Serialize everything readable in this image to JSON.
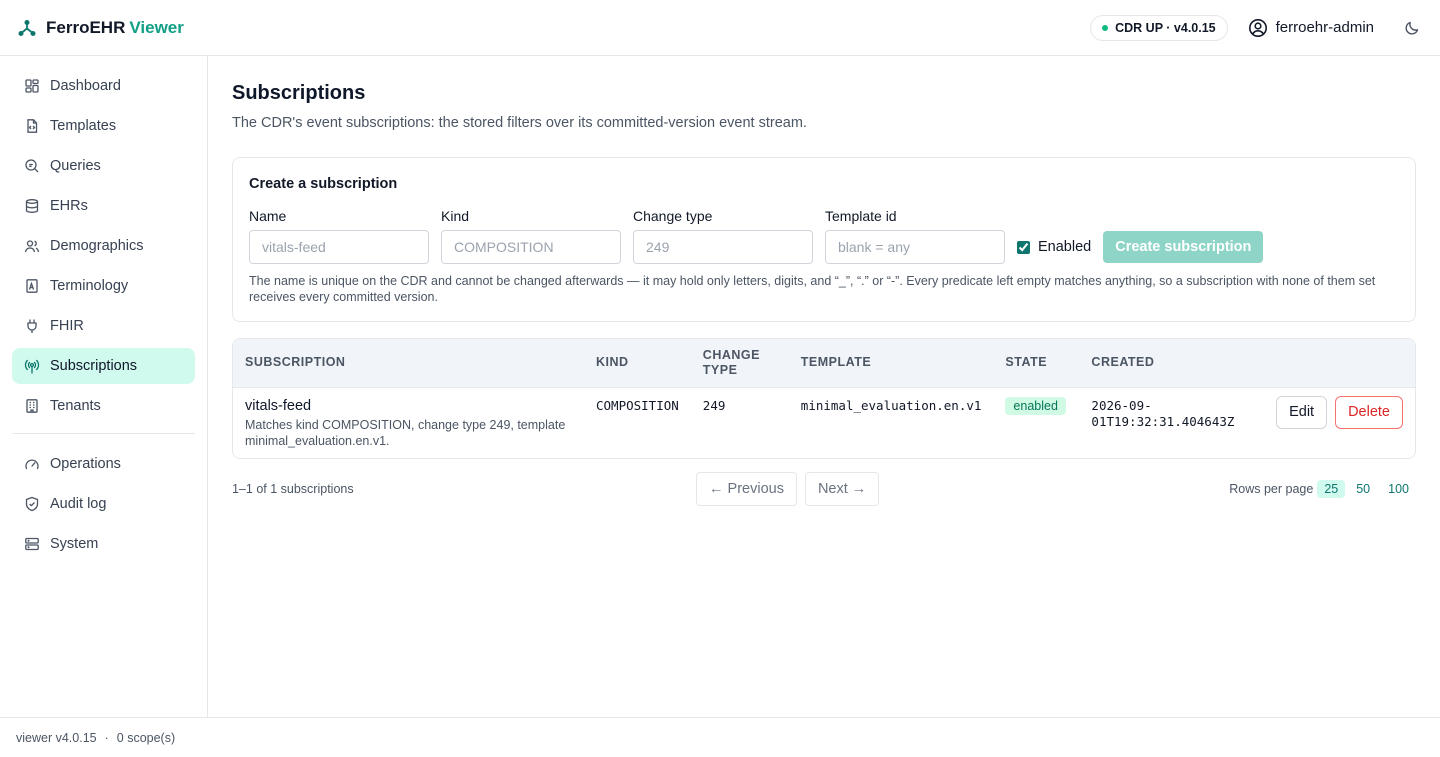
{
  "header": {
    "brand_name": "FerroEHR",
    "brand_accent": "Viewer",
    "status": "CDR UP · v4.0.15",
    "user": "ferroehr-admin",
    "icons": {
      "brand": "hub-icon",
      "user": "user-circle-icon",
      "theme": "moon-icon"
    }
  },
  "sidebar": {
    "items": [
      {
        "label": "Dashboard",
        "icon": "dashboard-icon"
      },
      {
        "label": "Templates",
        "icon": "template-icon"
      },
      {
        "label": "Queries",
        "icon": "query-icon"
      },
      {
        "label": "EHRs",
        "icon": "database-icon"
      },
      {
        "label": "Demographics",
        "icon": "people-icon"
      },
      {
        "label": "Terminology",
        "icon": "book-icon"
      },
      {
        "label": "FHIR",
        "icon": "plug-icon"
      },
      {
        "label": "Subscriptions",
        "icon": "broadcast-icon",
        "active": true
      },
      {
        "label": "Tenants",
        "icon": "building-icon"
      }
    ],
    "secondary": [
      {
        "label": "Operations",
        "icon": "gauge-icon"
      },
      {
        "label": "Audit log",
        "icon": "shield-icon"
      },
      {
        "label": "System",
        "icon": "server-icon"
      }
    ]
  },
  "page": {
    "title": "Subscriptions",
    "subtitle": "The CDR's event subscriptions: the stored filters over its committed-version event stream."
  },
  "form": {
    "title": "Create a subscription",
    "fields": {
      "name": {
        "label": "Name",
        "placeholder": "vitals-feed",
        "value": ""
      },
      "kind": {
        "label": "Kind",
        "placeholder": "COMPOSITION",
        "value": ""
      },
      "change_type": {
        "label": "Change type",
        "placeholder": "249",
        "value": ""
      },
      "template_id": {
        "label": "Template id",
        "placeholder": "blank = any",
        "value": ""
      }
    },
    "enabled_label": "Enabled",
    "enabled_checked": true,
    "submit_label": "Create subscription",
    "help": "The name is unique on the CDR and cannot be changed afterwards — it may hold only letters, digits, and “_”, “.” or “-”. Every predicate left empty matches anything, so a subscription with none of them set receives every committed version."
  },
  "table": {
    "columns": {
      "subscription": "Subscription",
      "kind": "Kind",
      "change_type_1": "Change",
      "change_type_2": "type",
      "template": "Template",
      "state": "State",
      "created": "Created"
    },
    "rows": [
      {
        "name": "vitals-feed",
        "description": "Matches kind COMPOSITION, change type 249, template minimal_evaluation.en.v1.",
        "kind": "COMPOSITION",
        "change_type": "249",
        "template": "minimal_evaluation.en.v1",
        "state": "enabled",
        "created_1": "2026-09-",
        "created_2": "01T19:32:31.404643Z",
        "edit_label": "Edit",
        "delete_label": "Delete"
      }
    ]
  },
  "pagination": {
    "summary": "1–1 of 1 subscriptions",
    "previous": "← Previous",
    "next": "Next →",
    "rows_per_page_label": "Rows per page",
    "options": [
      "25",
      "50",
      "100"
    ],
    "selected": "25"
  },
  "footer": {
    "version": "viewer v4.0.15",
    "separator": "·",
    "scopes": "0 scope(s)"
  },
  "colors": {
    "accent": "#0f9f86",
    "active_bg": "#d1faee",
    "danger": "#dc2626",
    "badge_bg": "#d1fae5"
  }
}
